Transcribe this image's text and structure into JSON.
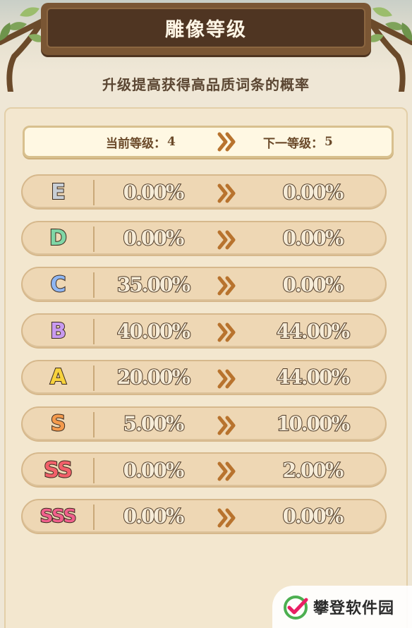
{
  "header": {
    "title": "雕像等级",
    "subtitle": "升级提高获得高品质词条的概率"
  },
  "level": {
    "current_label": "当前等级：",
    "current_value": "4",
    "next_label": "下一等级：",
    "next_value": "5"
  },
  "rows": [
    {
      "grade": "E",
      "color": "#c9cfd6",
      "current": "0.00%",
      "next": "0.00%"
    },
    {
      "grade": "D",
      "color": "#7fd6a6",
      "current": "0.00%",
      "next": "0.00%"
    },
    {
      "grade": "C",
      "color": "#8fb6f2",
      "current": "35.00%",
      "next": "0.00%"
    },
    {
      "grade": "B",
      "color": "#c89af0",
      "current": "40.00%",
      "next": "44.00%"
    },
    {
      "grade": "A",
      "color": "#f7d23d",
      "current": "20.00%",
      "next": "44.00%"
    },
    {
      "grade": "S",
      "color": "#f49a4c",
      "current": "5.00%",
      "next": "10.00%"
    },
    {
      "grade": "SS",
      "color": "#f2606a",
      "current": "0.00%",
      "next": "2.00%"
    },
    {
      "grade": "SSS",
      "color": "#f0608c",
      "current": "0.00%",
      "next": "0.00%"
    }
  ],
  "watermark": {
    "text": "攀登软件园",
    "icon": "checkmark-logo-icon"
  },
  "colors": {
    "arrow": "#b8732e",
    "title_plate": "#4f3522"
  }
}
